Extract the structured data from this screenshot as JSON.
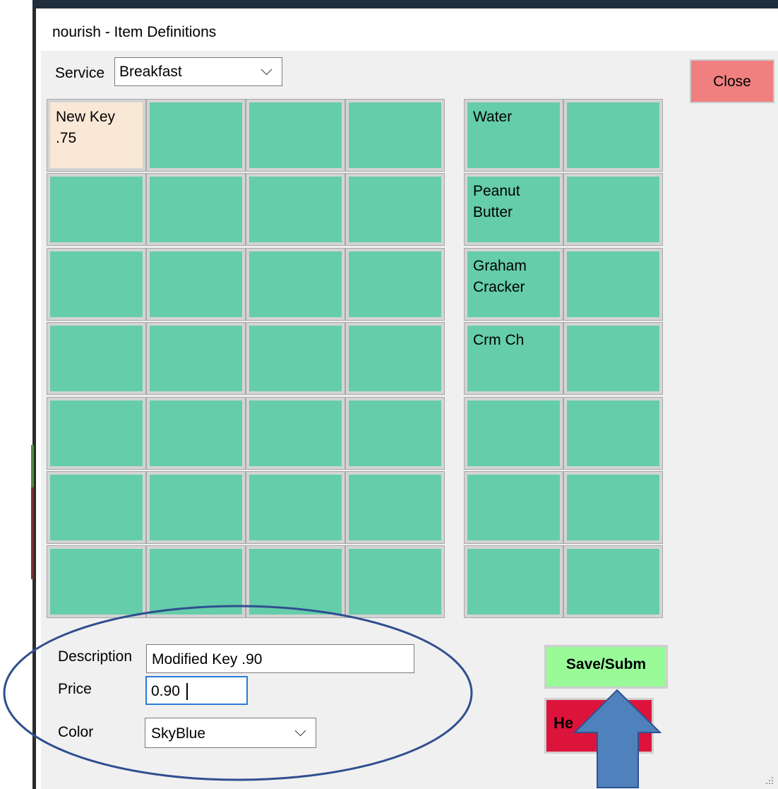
{
  "window": {
    "title": "nourish - Item Definitions"
  },
  "service": {
    "label": "Service",
    "selected": "Breakfast"
  },
  "buttons": {
    "close": "Close",
    "save": "Save/Subm",
    "help": "He"
  },
  "grid_left": [
    [
      "New Key\n.75",
      "",
      "",
      ""
    ],
    [
      "",
      "",
      "",
      ""
    ],
    [
      "",
      "",
      "",
      ""
    ],
    [
      "",
      "",
      "",
      ""
    ],
    [
      "",
      "",
      "",
      ""
    ],
    [
      "",
      "",
      "",
      ""
    ],
    [
      "",
      "",
      "",
      ""
    ]
  ],
  "grid_right": [
    [
      "Water",
      ""
    ],
    [
      "Peanut\nButter",
      ""
    ],
    [
      "Graham\nCracker",
      ""
    ],
    [
      "Crm Ch",
      ""
    ],
    [
      "",
      ""
    ],
    [
      "",
      ""
    ],
    [
      "",
      ""
    ]
  ],
  "form": {
    "description_label": "Description",
    "description_value": "Modified Key .90",
    "price_label": "Price",
    "price_value": "0.90",
    "color_label": "Color",
    "color_value": "SkyBlue"
  },
  "colors": {
    "key_green": "#66cdaa",
    "key_light": "#fae8d6",
    "close_red": "#f08080",
    "save_green": "#98fb98",
    "help_crimson": "#dc143c",
    "annotation_blue": "#4f81bd",
    "annotation_outline": "#2f4f8f"
  },
  "annotations": {
    "ellipse": "callout-ellipse",
    "arrow": "up-arrow"
  }
}
